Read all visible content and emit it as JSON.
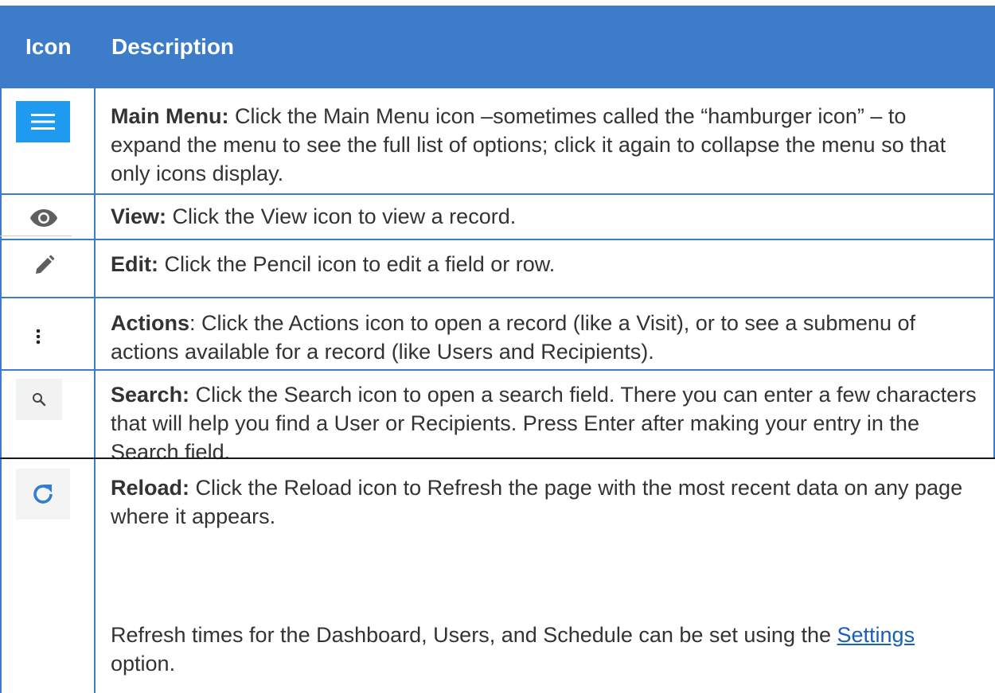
{
  "header": {
    "icon_col": "Icon",
    "description_col": "Description"
  },
  "rows": [
    {
      "icon": "hamburger-menu-icon",
      "term": "Main Menu:",
      "text": " Click the Main Menu icon –sometimes called the “hamburger icon” – to expand the menu to see the full list of options; click it again to collapse the menu so that only icons display."
    },
    {
      "icon": "eye-icon",
      "term": "View:",
      "text": " Click the View icon to view a record."
    },
    {
      "icon": "pencil-icon",
      "term": "Edit:",
      "text": " Click the Pencil icon to edit a field or row."
    },
    {
      "icon": "vertical-dots-icon",
      "term": "Actions",
      "text": ": Click the Actions icon to open a record (like a Visit), or to see a submenu of actions available for a record (like Users and Recipients)."
    },
    {
      "icon": "search-icon",
      "term": "Search:",
      "text": " Click the Search icon to open a search field.  There you can enter a few characters that will help you find a User or Recipients.  Press Enter after making your entry in the Search field."
    },
    {
      "icon": "reload-icon",
      "term": "Reload:",
      "text": " Click the Reload icon to Refresh the page with the most recent data on any page where it appears.",
      "extra_before": "Refresh times for the Dashboard, Users, and Schedule can be set using the ",
      "extra_link": "Settings",
      "extra_after": " option."
    }
  ],
  "colors": {
    "header_bg": "#3d7cc9",
    "menu_icon_bg": "#1e9af0",
    "reload_icon": "#2f7fd1",
    "link": "#1a5fb4"
  }
}
